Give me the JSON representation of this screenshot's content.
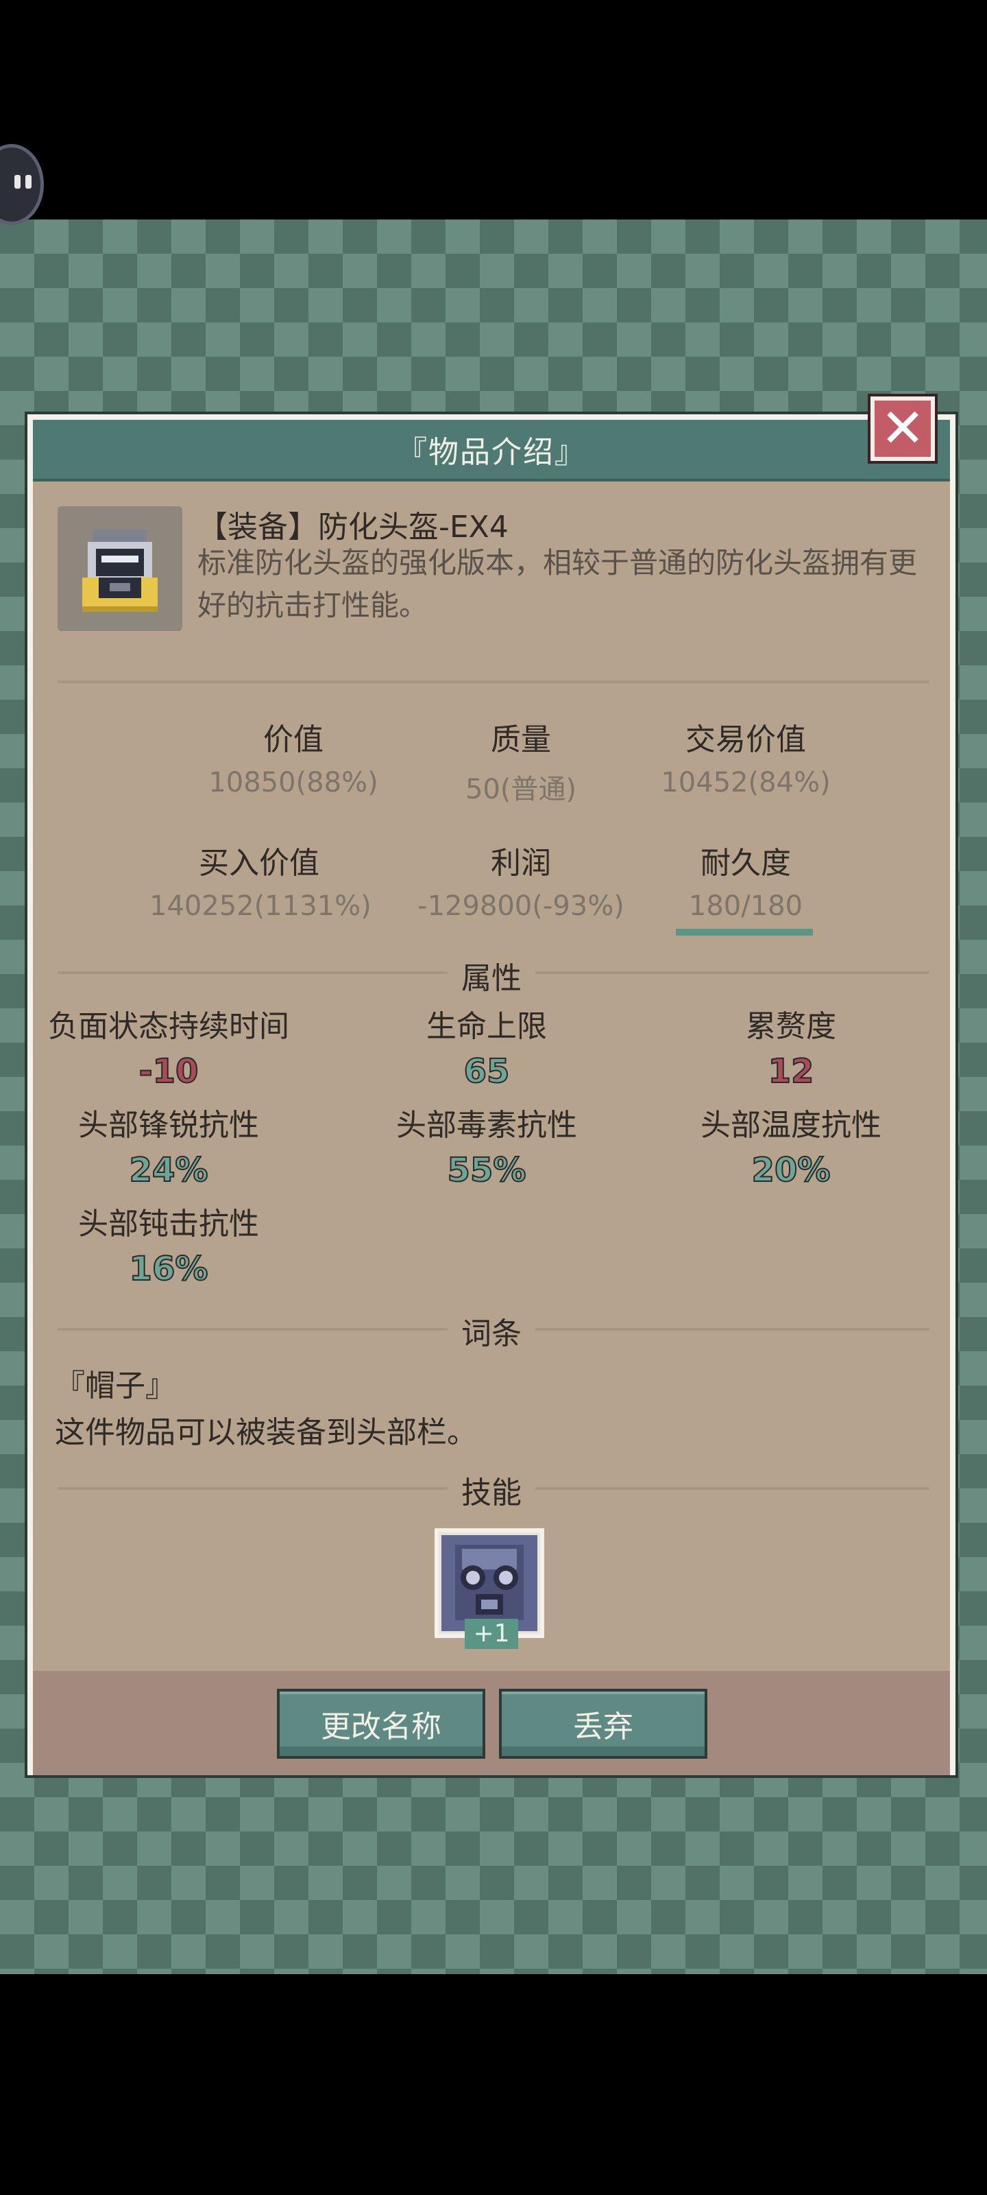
{
  "header": {
    "title": "『物品介绍』",
    "close_label": "✕"
  },
  "item": {
    "name": "【装备】防化头盔-EX4",
    "description": "标准防化头盔的强化版本，相较于普通的防化头盔拥有更好的抗击打性能。"
  },
  "stats": {
    "value": {
      "label": "价值",
      "value": "10850(88%)"
    },
    "quality": {
      "label": "质量",
      "value": "50(普通)"
    },
    "trade_value": {
      "label": "交易价值",
      "value": "10452(84%)"
    },
    "buy_value": {
      "label": "买入价值",
      "value": "140252(1131%)"
    },
    "profit": {
      "label": "利润",
      "value": "-129800(-93%)"
    },
    "durability": {
      "label": "耐久度",
      "value": "180/180",
      "fraction": 1.0
    }
  },
  "attributes": {
    "title": "属性",
    "items": [
      {
        "label": "负面状态持续时间",
        "value": "-10",
        "color": "#a94b59"
      },
      {
        "label": "生命上限",
        "value": "65",
        "color": "#6fa596"
      },
      {
        "label": "累赘度",
        "value": "12",
        "color": "#a94b59"
      },
      {
        "label": "头部锋锐抗性",
        "value": "24%",
        "color": "#6fa596"
      },
      {
        "label": "头部毒素抗性",
        "value": "55%",
        "color": "#6fa596"
      },
      {
        "label": "头部温度抗性",
        "value": "20%",
        "color": "#6fa596"
      },
      {
        "label": "头部钝击抗性",
        "value": "16%",
        "color": "#6fa596"
      }
    ]
  },
  "traits": {
    "title": "词条",
    "name": "『帽子』",
    "description": "这件物品可以被装备到头部栏。"
  },
  "skills": {
    "title": "技能",
    "items": [
      {
        "icon": "gasmask-skill-icon",
        "badge": "+1"
      }
    ]
  },
  "actions": {
    "rename": "更改名称",
    "discard": "丢弃"
  }
}
